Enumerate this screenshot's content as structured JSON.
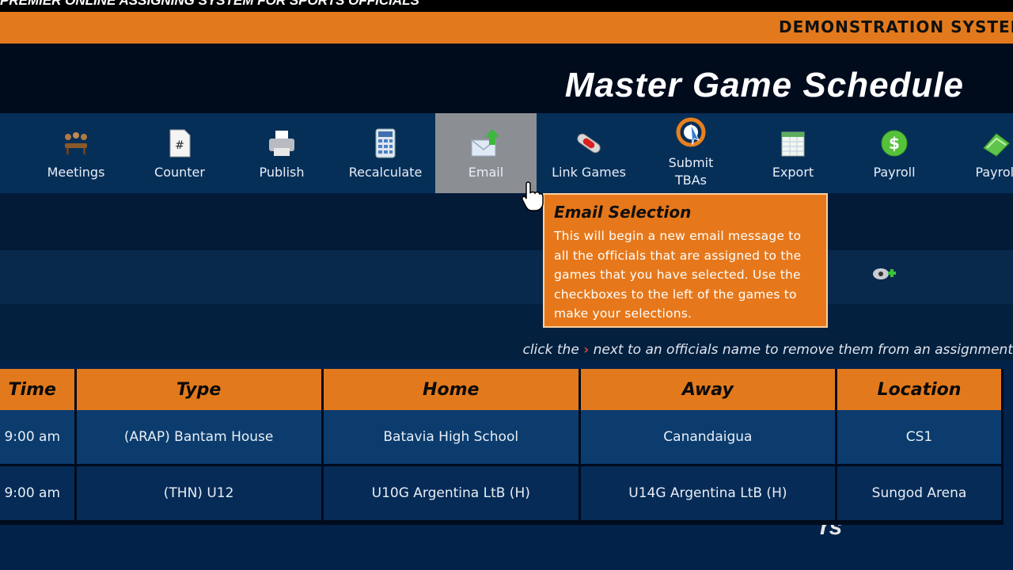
{
  "header": {
    "brand": "PREMIER ONLINE ASSIGNING SYSTEM FOR SPORTS OFFICIALS",
    "demo_banner": "DEMONSTRATION SYSTEM",
    "page_title": "Master Game Schedule"
  },
  "toolbar": {
    "items": [
      {
        "label": "Meetings",
        "icon": "meetings-icon"
      },
      {
        "label": "Counter",
        "icon": "counter-icon"
      },
      {
        "label": "Publish",
        "icon": "printer-icon"
      },
      {
        "label": "Recalculate",
        "icon": "calculator-icon"
      },
      {
        "label": "Email",
        "icon": "email-icon",
        "active": true
      },
      {
        "label": "Link Games",
        "icon": "link-icon"
      },
      {
        "label": "Submit TBAs",
        "icon": "submit-tba-icon"
      },
      {
        "label": "Export",
        "icon": "export-icon"
      },
      {
        "label": "Payroll",
        "icon": "dollar-icon"
      },
      {
        "label": "Payroll",
        "icon": "money-icon"
      }
    ]
  },
  "tooltip": {
    "title": "Email Selection",
    "body": "This will begin a new email message to all the officials that are assigned to the games that you have selected. Use the checkboxes to the left of the games to make your selections."
  },
  "hidden_heading_fragment": "rs",
  "hint": {
    "before": "click the",
    "after": "next to an officials name to remove them from an assignment"
  },
  "table": {
    "columns": [
      "Time",
      "Type",
      "Home",
      "Away",
      "Location"
    ],
    "rows": [
      [
        "9:00 am",
        "(ARAP) Bantam House",
        "Batavia High School",
        "Canandaigua",
        "CS1"
      ],
      [
        "9:00 am",
        "(THN) U12",
        "U10G Argentina LtB (H)",
        "U14G Argentina LtB (H)",
        "Sungod Arena"
      ]
    ]
  },
  "colors": {
    "accent_orange": "#e27a1d",
    "navy": "#02224a",
    "active_tool": "#8b8f94"
  }
}
